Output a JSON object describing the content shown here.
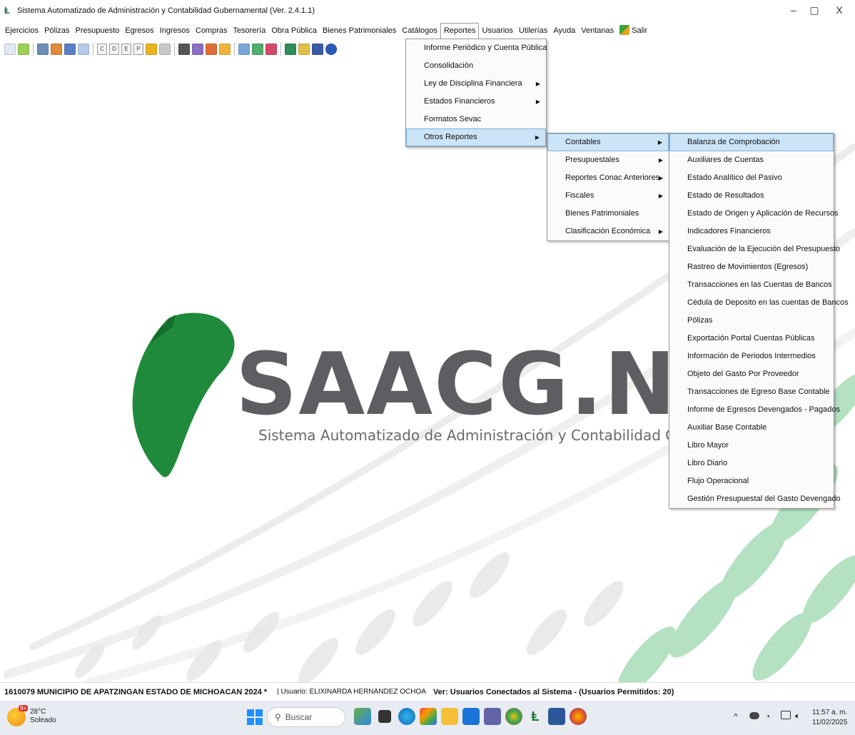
{
  "window": {
    "title": "Sistema Automatizado de Administración y Contabilidad Gubernamental  (Ver. 2.4.1.1)",
    "controls": {
      "minimize": "–",
      "restore": "▢",
      "close": "X"
    }
  },
  "menubar": {
    "items": [
      "Ejercicios",
      "Pólizas",
      "Presupuesto",
      "Egresos",
      "Ingresos",
      "Compras",
      "Tesorería",
      "Obra Pública",
      "Bienes Patrimoniales",
      "Catálogos",
      "Reportes",
      "Usuarios",
      "Utilerías",
      "Ayuda",
      "Ventanas",
      "Salir"
    ],
    "active": "Reportes"
  },
  "reportes_menu": {
    "items": [
      {
        "label": "Informe Periódico y Cuenta Pública",
        "submenu": false
      },
      {
        "label": "Consolidación",
        "submenu": false
      },
      {
        "label": "Ley de Disciplina Financiera",
        "submenu": true
      },
      {
        "label": "Estados Financieros",
        "submenu": true
      },
      {
        "label": "Formatos Sevac",
        "submenu": false
      },
      {
        "label": "Otros Reportes",
        "submenu": true,
        "highlighted": true
      }
    ]
  },
  "otros_reportes_menu": {
    "items": [
      {
        "label": "Contables",
        "submenu": true,
        "highlighted": true
      },
      {
        "label": "Presupuestales",
        "submenu": true
      },
      {
        "label": "Reportes Conac Anteriores",
        "submenu": true
      },
      {
        "label": "Fiscales",
        "submenu": true
      },
      {
        "label": "Bienes Patrimoniales",
        "submenu": false
      },
      {
        "label": "Clasificación Económica",
        "submenu": true
      }
    ]
  },
  "contables_menu": {
    "items": [
      "Balanza de Comprobación",
      "Auxiliares de Cuentas",
      "Estado Analítico del Pasivo",
      "Estado de Resultados",
      "Estado de Origen y Aplicación de Recursos",
      "Indicadores Financieros",
      "Evaluación de la Ejecución del Presupuesto",
      "Rastreo de  Movimientos (Egresos)",
      "Transacciones en las Cuentas de Bancos",
      "Cédula de Deposito en las cuentas de Bancos",
      "Pólizas",
      "Exportación Portal Cuentas Públicas",
      "Información de Periodos Intermedios",
      "Objeto del Gasto Por Proveedor",
      "Transacciones de Egreso Base Contable",
      "Informe de Egresos Devengados - Pagados",
      "Auxiliar Base Contable",
      "Libro Mayor",
      "Libro Diario",
      "Flujo Operacional",
      "Gestión Presupuestal del Gasto Devengado"
    ],
    "highlighted": "Balanza de Comprobación"
  },
  "logo": {
    "text_main": "SAACG.NE",
    "subtitle": "Sistema Automatizado de Administración y Contabilidad Gube"
  },
  "statusbar": {
    "entity": "1610079 MUNICIPIO DE APATZINGAN ESTADO DE MICHOACAN  2024  *",
    "user": "| Usuario: ELIXINARDA HERNANDEZ OCHOA",
    "connected": "Ver: Usuarios Conectados al Sistema - (Usuarios Permitidos: 20)"
  },
  "taskbar": {
    "weather_badge": "9+",
    "temperature": "28°C",
    "condition": "Soleado",
    "search_placeholder": "Buscar",
    "time": "11:57 a. m.",
    "date": "11/02/2025"
  },
  "colors": {
    "accent_green": "#1f8a3c",
    "logo_gray": "#5e5e62",
    "menu_highlight": "#cce4f7"
  }
}
